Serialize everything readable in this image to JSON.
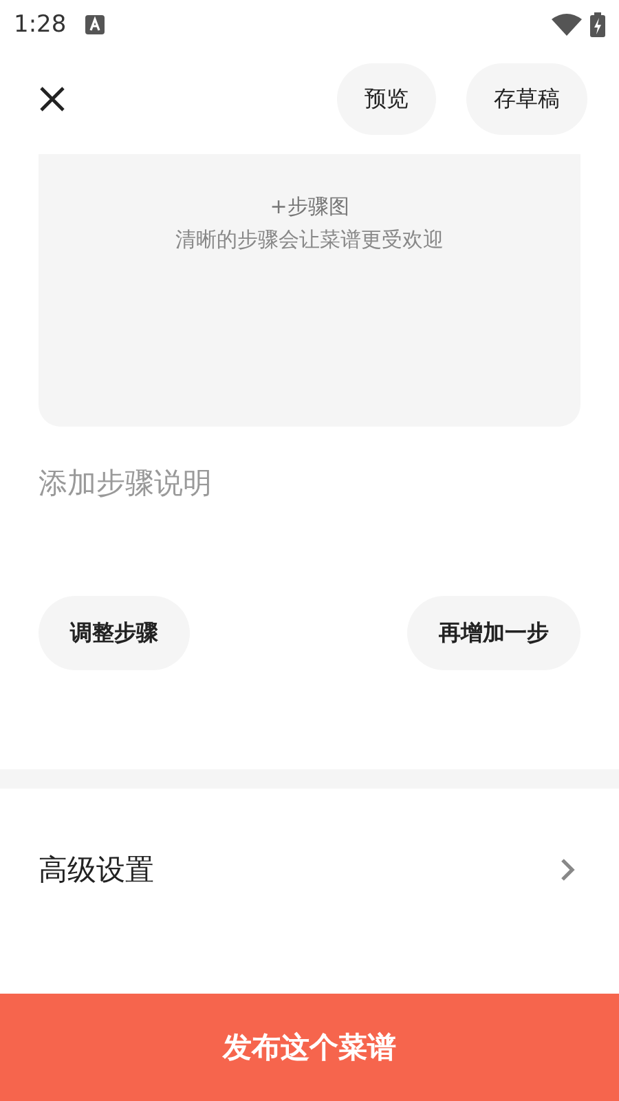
{
  "status_bar": {
    "time": "1:28"
  },
  "toolbar": {
    "buttons": [
      "预览",
      "存草稿"
    ]
  },
  "step": {
    "photo_label": "+步骤图",
    "photo_hint": "清晰的步骤会让菜谱更受欢迎",
    "description_placeholder": "添加步骤说明"
  },
  "step_actions": [
    "调整步骤",
    "再增加一步"
  ],
  "settings_row": {
    "label": "高级设置"
  },
  "publish_button": "发布这个菜谱"
}
